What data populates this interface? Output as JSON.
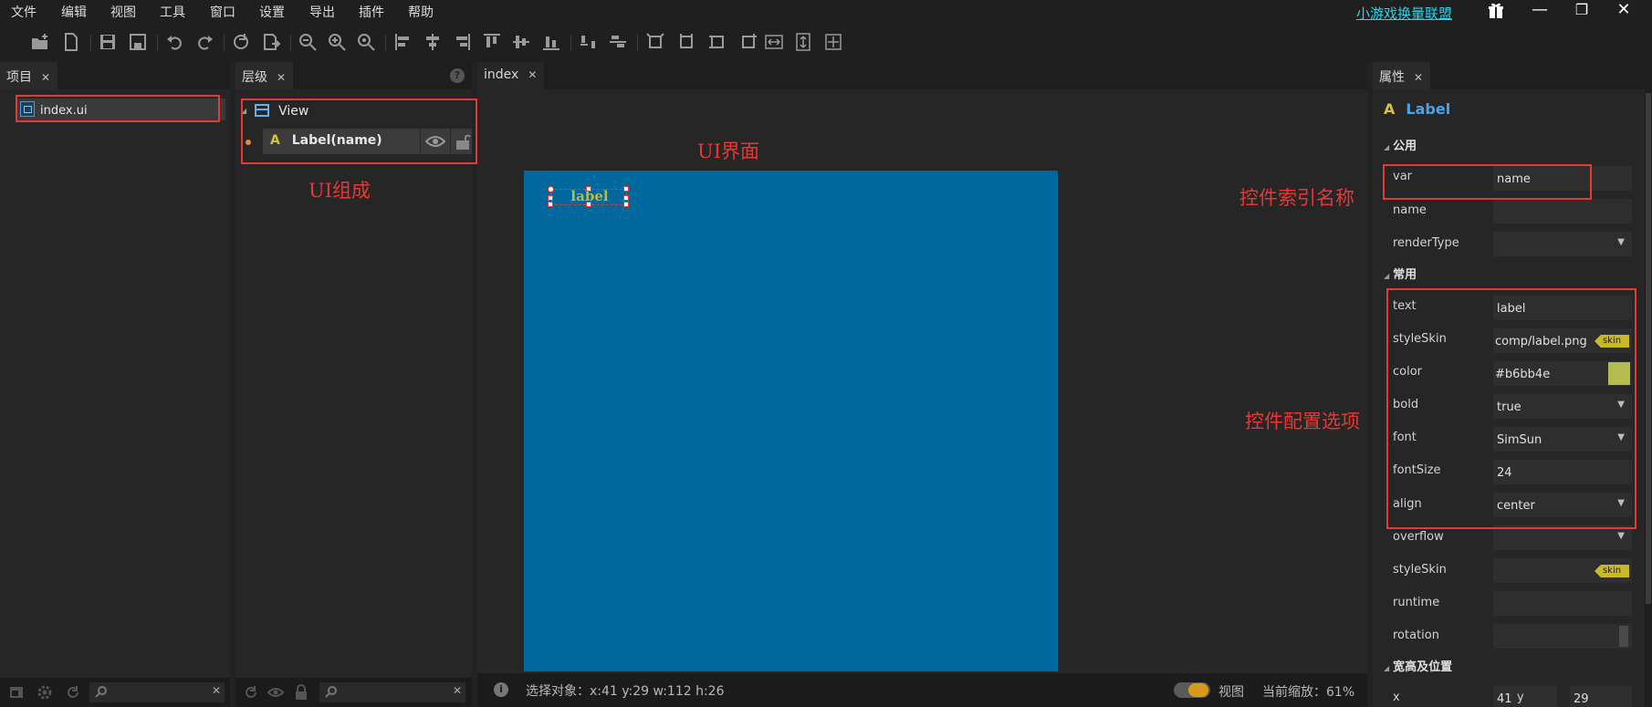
{
  "menu": [
    "文件",
    "编辑",
    "视图",
    "工具",
    "窗口",
    "设置",
    "导出",
    "插件",
    "帮助"
  ],
  "sponsor": "小游戏换量联盟",
  "window_buttons": {
    "gift": "gift-icon",
    "minimize": "—",
    "restore": "❐",
    "close": "✕"
  },
  "panels": {
    "project": {
      "tab": "项目",
      "file": "index.ui"
    },
    "layers": {
      "tab": "层级",
      "root": "View",
      "child": "Label(name)"
    },
    "editor": {
      "tab": "index"
    },
    "props": {
      "tab": "属性",
      "component": "Label"
    }
  },
  "canvas": {
    "label_text": "label"
  },
  "annotations": {
    "ui_compose": "UI组成",
    "ui_interface": "UI界面",
    "index_name": "控件索引名称",
    "config_options": "控件配置选项"
  },
  "sections": {
    "common_public": "公用",
    "common": "常用",
    "size_pos": "宽高及位置"
  },
  "props": {
    "var": {
      "label": "var",
      "value": "name"
    },
    "name": {
      "label": "name",
      "value": ""
    },
    "renderType": {
      "label": "renderType",
      "value": ""
    },
    "text": {
      "label": "text",
      "value": "label"
    },
    "styleSkin": {
      "label": "styleSkin",
      "value": "comp/label.png",
      "tag": "skin"
    },
    "color": {
      "label": "color",
      "value": "#b6bb4e",
      "swatch": "#b6bb4e"
    },
    "bold": {
      "label": "bold",
      "value": "true"
    },
    "font": {
      "label": "font",
      "value": "SimSun"
    },
    "fontSize": {
      "label": "fontSize",
      "value": "24"
    },
    "align": {
      "label": "align",
      "value": "center"
    },
    "overflow": {
      "label": "overflow",
      "value": ""
    },
    "styleSkin2": {
      "label": "styleSkin",
      "value": "",
      "tag": "skin"
    },
    "runtime": {
      "label": "runtime",
      "value": ""
    },
    "rotation": {
      "label": "rotation",
      "value": ""
    },
    "x": {
      "label": "x",
      "value": "41"
    },
    "y": {
      "label": "y",
      "value": "29"
    }
  },
  "status": {
    "selection": "选择对象：x:41 y:29  w:112 h:26",
    "view_label": "视图",
    "zoom": "当前缩放：61%"
  }
}
